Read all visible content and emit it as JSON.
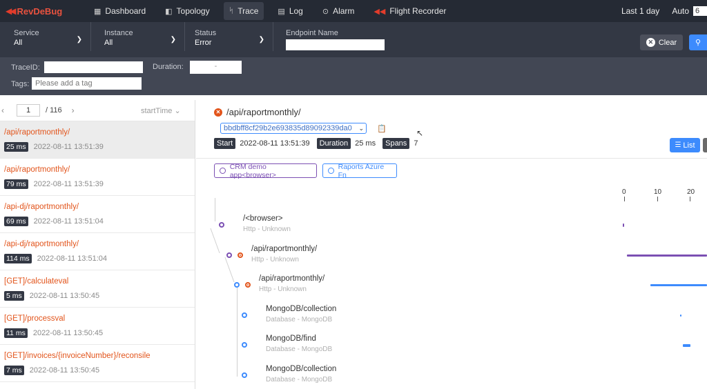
{
  "app": {
    "logo_mark": "◀◀",
    "logo_text": "RevDeBug"
  },
  "nav": [
    {
      "icon": "▦",
      "label": "Dashboard"
    },
    {
      "icon": "◧",
      "label": "Topology"
    },
    {
      "icon": "ᛋ",
      "label": "Trace"
    },
    {
      "icon": "▤",
      "label": "Log"
    },
    {
      "icon": "⊙",
      "label": "Alarm"
    },
    {
      "icon": "◀◀",
      "label": "Flight Recorder"
    }
  ],
  "nav_right": {
    "range": "Last 1 day",
    "auto": "Auto",
    "auto_value": "6"
  },
  "filters": {
    "service": {
      "label": "Service",
      "value": "All"
    },
    "instance": {
      "label": "Instance",
      "value": "All"
    },
    "status": {
      "label": "Status",
      "value": "Error"
    },
    "endpoint": {
      "label": "Endpoint Name",
      "value": ""
    },
    "clear_label": "Clear"
  },
  "tracebar": {
    "traceid_label": "TraceID:",
    "duration_label": "Duration:",
    "duration_sep": "-",
    "tags_label": "Tags:",
    "tags_placeholder": "Please add a tag"
  },
  "pager": {
    "page": "1",
    "total": "/ 116",
    "sort": "startTime"
  },
  "traces": [
    {
      "path": "/api/raportmonthly/",
      "duration": "25 ms",
      "time": "2022-08-11 13:51:39"
    },
    {
      "path": "/api/raportmonthly/",
      "duration": "79 ms",
      "time": "2022-08-11 13:51:39"
    },
    {
      "path": "/api-dj/raportmonthly/",
      "duration": "69 ms",
      "time": "2022-08-11 13:51:04"
    },
    {
      "path": "/api-dj/raportmonthly/",
      "duration": "114 ms",
      "time": "2022-08-11 13:51:04"
    },
    {
      "path": "[GET]/calculateval",
      "duration": "5 ms",
      "time": "2022-08-11 13:50:45"
    },
    {
      "path": "[GET]/processval",
      "duration": "11 ms",
      "time": "2022-08-11 13:50:45"
    },
    {
      "path": "[GET]/invoices/{invoiceNumber}/reconsile",
      "duration": "7 ms",
      "time": "2022-08-11 13:50:45"
    }
  ],
  "detail": {
    "title": "/api/raportmonthly/",
    "trace_id": "bbdbff8cf29b2e693835d89092339da0",
    "start_label": "Start",
    "start": "2022-08-11 13:51:39",
    "duration_label": "Duration",
    "duration": "25 ms",
    "spans_label": "Spans",
    "spans": "7",
    "list_label": "List",
    "services": [
      "CRM demo app<browser>",
      "Raports Azure Fn"
    ],
    "ticks": [
      "0",
      "10",
      "20"
    ]
  },
  "spans": [
    {
      "name": "/<browser>",
      "sub": "Http - Unknown"
    },
    {
      "name": "/api/raportmonthly/",
      "sub": "Http - Unknown"
    },
    {
      "name": "/api/raportmonthly/",
      "sub": "Http - Unknown"
    },
    {
      "name": "MongoDB/collection",
      "sub": "Database - MongoDB"
    },
    {
      "name": "MongoDB/find",
      "sub": "Database - MongoDB"
    },
    {
      "name": "MongoDB/collection",
      "sub": "Database - MongoDB"
    }
  ],
  "colors": {
    "browser": "#7b4fb3",
    "azure": "#3d8bfd",
    "error": "#e2541b",
    "nav_bg": "#252a34"
  }
}
